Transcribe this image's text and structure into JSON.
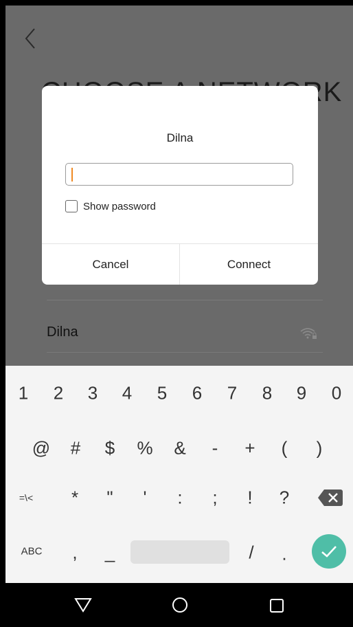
{
  "background": {
    "title": "CHOOSE A NETWORK",
    "network": {
      "name": "Dilna",
      "icon": "wifi-locked-icon"
    }
  },
  "dialog": {
    "title": "Dilna",
    "password_value": "",
    "show_password_label": "Show password",
    "show_password_checked": false,
    "cancel_label": "Cancel",
    "connect_label": "Connect"
  },
  "keyboard": {
    "row1": [
      "1",
      "2",
      "3",
      "4",
      "5",
      "6",
      "7",
      "8",
      "9",
      "0"
    ],
    "row2": [
      "@",
      "#",
      "$",
      "%",
      "&",
      "-",
      "+",
      "(",
      ")"
    ],
    "row3": [
      "=\\<",
      "*",
      "\"",
      "'",
      ":",
      ";",
      "!",
      "?"
    ],
    "row4": [
      "ABC",
      ",",
      "_",
      "/",
      "."
    ],
    "backspace_icon": "backspace-icon",
    "enter_icon": "check-icon",
    "accent_color": "#4fbea7"
  },
  "navbar": {
    "icons": [
      "back-triangle-icon",
      "home-circle-icon",
      "recents-square-icon"
    ]
  }
}
